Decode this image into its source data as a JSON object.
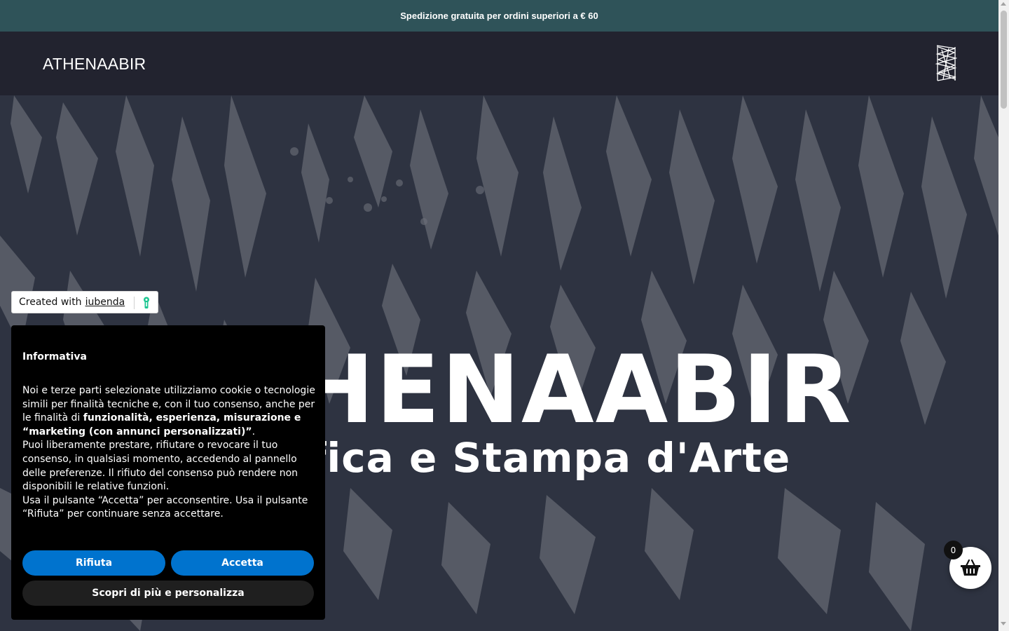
{
  "announcement": {
    "text": "Spedizione gratuita per ordini superiori a € 60"
  },
  "header": {
    "logo_text": "ATHENAABIR",
    "logo_mark_icon": "athenaabir-monogram-icon"
  },
  "hero": {
    "title": "ATHENAABIR",
    "subtitle": "Grafica e Stampa d'Arte"
  },
  "iubenda": {
    "prefix": "Created with",
    "link": "iubenda",
    "icon": "iubenda-keyhole-icon",
    "icon_color": "#1cc691"
  },
  "cookie_banner": {
    "title": "Informativa",
    "p1_a": "Noi e terze parti selezionate utilizziamo cookie o tecnologie simili per finalità tecniche e, con il tuo consenso, anche per le finalità di ",
    "p1_b": "funzionalità, esperienza, misurazione e “marketing (con annunci personalizzati)”",
    "p1_c": ".",
    "p2": "Puoi liberamente prestare, rifiutare o revocare il tuo consenso, in qualsiasi momento, accedendo al pannello delle preferenze. Il rifiuto del consenso può rendere non disponibili le relative funzioni.",
    "p3": "Usa il pulsante “Accetta” per acconsentire. Usa il pulsante “Rifiuta” per continuare senza accettare.",
    "reject_label": "Rifiuta",
    "accept_label": "Accetta",
    "customize_label": "Scopri di più e personalizza",
    "button_color": "#0073ce"
  },
  "cart": {
    "count": "0",
    "icon": "basket-icon"
  },
  "colors": {
    "announcement_bg": "#2f5359",
    "header_bg": "#22232f"
  }
}
